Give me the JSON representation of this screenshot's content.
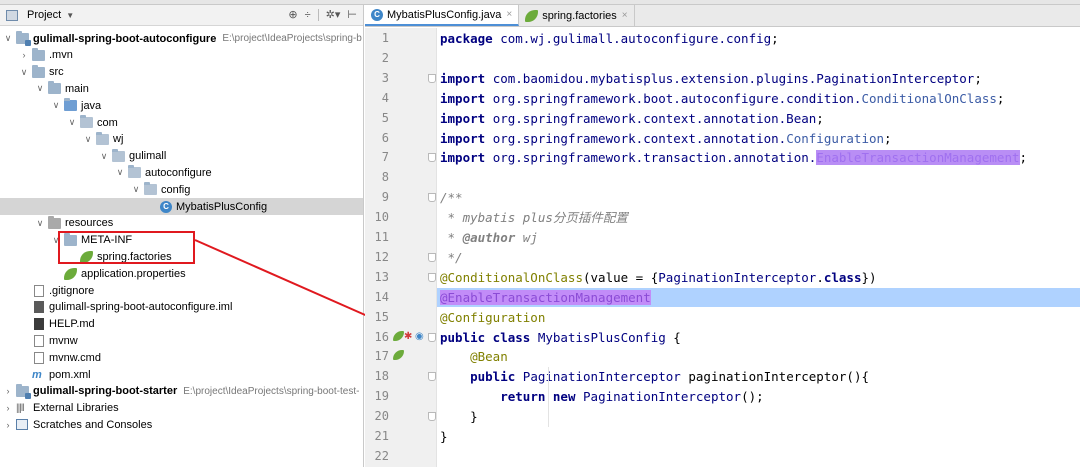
{
  "project_panel": {
    "title": "Project",
    "tree": [
      {
        "label": "gulimall-spring-boot-autoconfigure",
        "path": "E:\\project\\IdeaProjects\\spring-b",
        "arrow": "∨",
        "icon": "module-folder-icon",
        "indent": 0,
        "bold": true
      },
      {
        "label": ".mvn",
        "arrow": "›",
        "icon": "folder-icon",
        "indent": 1
      },
      {
        "label": "src",
        "arrow": "∨",
        "icon": "folder-icon",
        "indent": 1
      },
      {
        "label": "main",
        "arrow": "∨",
        "icon": "folder-icon",
        "indent": 2
      },
      {
        "label": "java",
        "arrow": "∨",
        "icon": "source-folder-icon",
        "indent": 3
      },
      {
        "label": "com",
        "arrow": "∨",
        "icon": "package-icon",
        "indent": 4
      },
      {
        "label": "wj",
        "arrow": "∨",
        "icon": "package-icon",
        "indent": 5
      },
      {
        "label": "gulimall",
        "arrow": "∨",
        "icon": "package-icon",
        "indent": 6
      },
      {
        "label": "autoconfigure",
        "arrow": "∨",
        "icon": "package-icon",
        "indent": 7
      },
      {
        "label": "config",
        "arrow": "∨",
        "icon": "package-icon",
        "indent": 8
      },
      {
        "label": "MybatisPlusConfig",
        "arrow": "",
        "icon": "class-icon",
        "indent": 9,
        "selected": true
      },
      {
        "label": "resources",
        "arrow": "∨",
        "icon": "resources-folder-icon",
        "indent": 2
      },
      {
        "label": "META-INF",
        "arrow": "∨",
        "icon": "folder-icon",
        "indent": 3
      },
      {
        "label": "spring.factories",
        "arrow": "",
        "icon": "spring-leaf-icon",
        "indent": 4
      },
      {
        "label": "application.properties",
        "arrow": "",
        "icon": "spring-leaf-icon",
        "indent": 3
      },
      {
        "label": ".gitignore",
        "arrow": "",
        "icon": "file-icon",
        "indent": 1
      },
      {
        "label": "gulimall-spring-boot-autoconfigure.iml",
        "arrow": "",
        "icon": "iml-file-icon",
        "indent": 1
      },
      {
        "label": "HELP.md",
        "arrow": "",
        "icon": "markdown-file-icon",
        "indent": 1
      },
      {
        "label": "mvnw",
        "arrow": "",
        "icon": "file-icon",
        "indent": 1
      },
      {
        "label": "mvnw.cmd",
        "arrow": "",
        "icon": "file-icon",
        "indent": 1
      },
      {
        "label": "pom.xml",
        "arrow": "",
        "icon": "maven-icon",
        "indent": 1
      },
      {
        "label": "gulimall-spring-boot-starter",
        "path": "E:\\project\\IdeaProjects\\spring-boot-test-",
        "arrow": "›",
        "icon": "module-folder-icon",
        "indent": 0,
        "bold": true
      },
      {
        "label": "External Libraries",
        "arrow": "›",
        "icon": "libraries-icon",
        "indent": 0
      },
      {
        "label": "Scratches and Consoles",
        "arrow": "›",
        "icon": "scratches-icon",
        "indent": 0
      }
    ]
  },
  "tabs": [
    {
      "label": "MybatisPlusConfig.java",
      "icon": "class-icon",
      "active": true
    },
    {
      "label": "spring.factories",
      "icon": "spring-leaf-icon",
      "active": false
    }
  ],
  "editor": {
    "highlighted_line": 14,
    "lines": [
      {
        "n": "1",
        "html": "<span class='kw'>package</span> <span class='pk'>com.wj.gulimall.autoconfigure.config</span>;"
      },
      {
        "n": "2",
        "html": ""
      },
      {
        "n": "3",
        "html": "<span class='kw'>import</span> <span class='pk'>com.baomidou.mybatisplus.extension.plugins.PaginationInterceptor</span>;"
      },
      {
        "n": "4",
        "html": "<span class='kw'>import</span> <span class='pk'>org.springframework.boot.autoconfigure.condition.</span><span class='pk' style='color:#3b5ba5'>ConditionalOnClass</span>;"
      },
      {
        "n": "5",
        "html": "<span class='kw'>import</span> <span class='pk'>org.springframework.context.annotation.Bean</span>;"
      },
      {
        "n": "6",
        "html": "<span class='kw'>import</span> <span class='pk'>org.springframework.context.annotation.</span><span class='pk' style='color:#3b5ba5'>Configuration</span>;"
      },
      {
        "n": "7",
        "html": "<span class='kw'>import</span> <span class='pk'>org.springframework.transaction.annotation.</span><span class='cls-unresolved'>EnableTransactionManagement</span>;"
      },
      {
        "n": "8",
        "html": ""
      },
      {
        "n": "9",
        "html": "<span class='cm'>/**</span>"
      },
      {
        "n": "10",
        "html": "<span class='cm'> * mybatis plus分页插件配置</span>"
      },
      {
        "n": "11",
        "html": "<span class='cm'> * </span><span class='cm' style='font-weight:bold'>@author</span><span class='cm'> wj</span>"
      },
      {
        "n": "12",
        "html": "<span class='cm'> */</span>"
      },
      {
        "n": "13",
        "html": "<span class='ann'>@ConditionalOnClass</span>(value = {<span class='pk'>PaginationInterceptor</span>.<span class='kw'>class</span>})"
      },
      {
        "n": "14",
        "html": "<span class='ann-un'>@EnableTransactionManagement</span>"
      },
      {
        "n": "15",
        "html": "<span class='ann'>@Configuration</span>"
      },
      {
        "n": "16",
        "html": "<span class='kw'>public class</span> <span class='pk'>MybatisPlusConfig</span> {"
      },
      {
        "n": "17",
        "html": "    <span class='ann'>@Bean</span>"
      },
      {
        "n": "18",
        "html": "    <span class='kw'>public</span> <span class='pk'>PaginationInterceptor</span> <span style='color:#000'>paginationInterceptor</span>(){"
      },
      {
        "n": "19",
        "html": "        <span class='kw'>return new</span> <span class='pk'>PaginationInterceptor</span>();"
      },
      {
        "n": "20",
        "html": "    }"
      },
      {
        "n": "21",
        "html": "}"
      },
      {
        "n": "22",
        "html": ""
      }
    ]
  },
  "colors": {
    "annotation_box": "#e0191f",
    "arrow": "#e0191f",
    "line_highlight": "#afd2ff"
  }
}
